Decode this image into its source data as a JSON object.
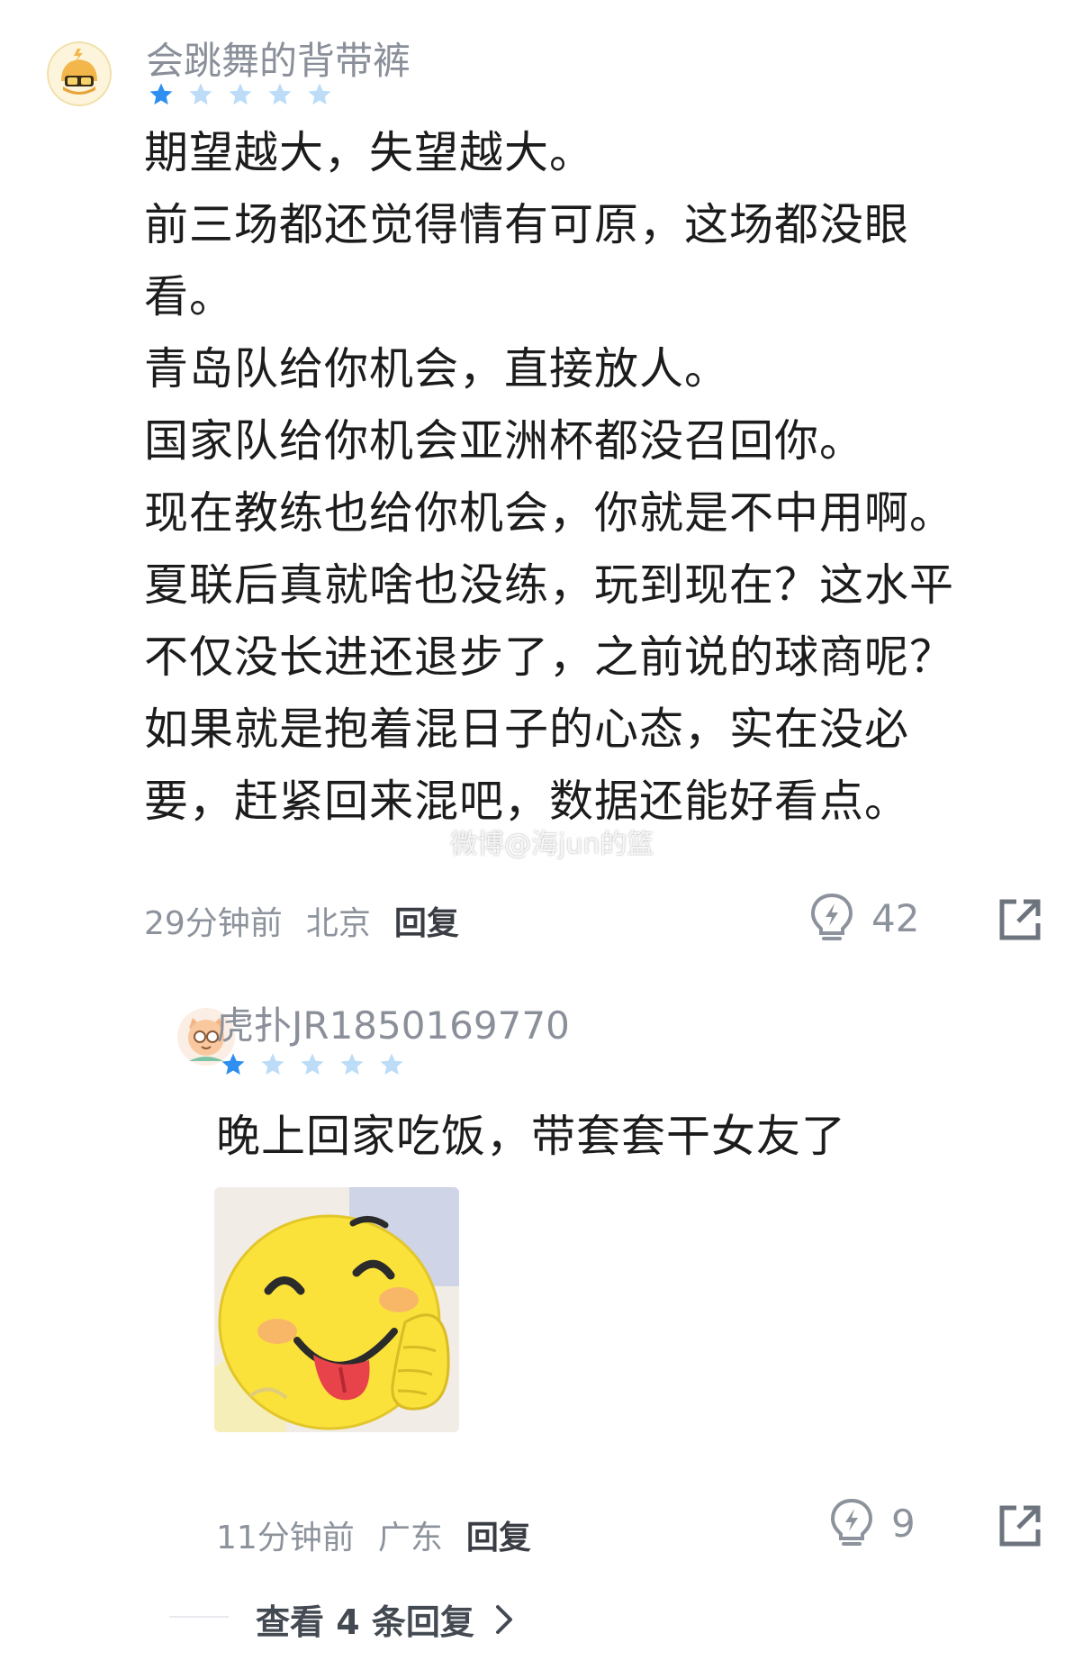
{
  "comment1": {
    "username": "会跳舞的背带裤",
    "rating": 1,
    "rating_max": 5,
    "lines": [
      "期望越大，失望越大。",
      "前三场都还觉得情有可原，这场都没眼",
      "看。",
      "青岛队给你机会，直接放人。",
      "国家队给你机会亚洲杯都没召回你。",
      "现在教练也给你机会，你就是不中用啊。",
      "夏联后真就啥也没练，玩到现在？这水平",
      "不仅没长进还退步了，之前说的球商呢？",
      "如果就是抱着混日子的心态，实在没必",
      "要，赶紧回来混吧，数据还能好看点。"
    ],
    "time": "29分钟前",
    "location": "北京",
    "reply_label": "回复",
    "likes": "42"
  },
  "comment2": {
    "username": "虎扑JR1850169770",
    "rating": 1,
    "rating_max": 5,
    "text": "晚上回家吃饭，带套套干女友了",
    "time": "11分钟前",
    "location": "广东",
    "reply_label": "回复",
    "likes": "9"
  },
  "more_replies": "查看 4 条回复",
  "watermark": "微博@海jun的篮",
  "colors": {
    "star_active": "#2f8ff0",
    "star_inactive": "#bcdcf8",
    "meta_text": "#8d939c",
    "username": "#8a8f99"
  },
  "icons": {
    "like": "lightning-bulb-icon",
    "share": "share-arrow-icon",
    "chevron": "chevron-right-icon"
  }
}
